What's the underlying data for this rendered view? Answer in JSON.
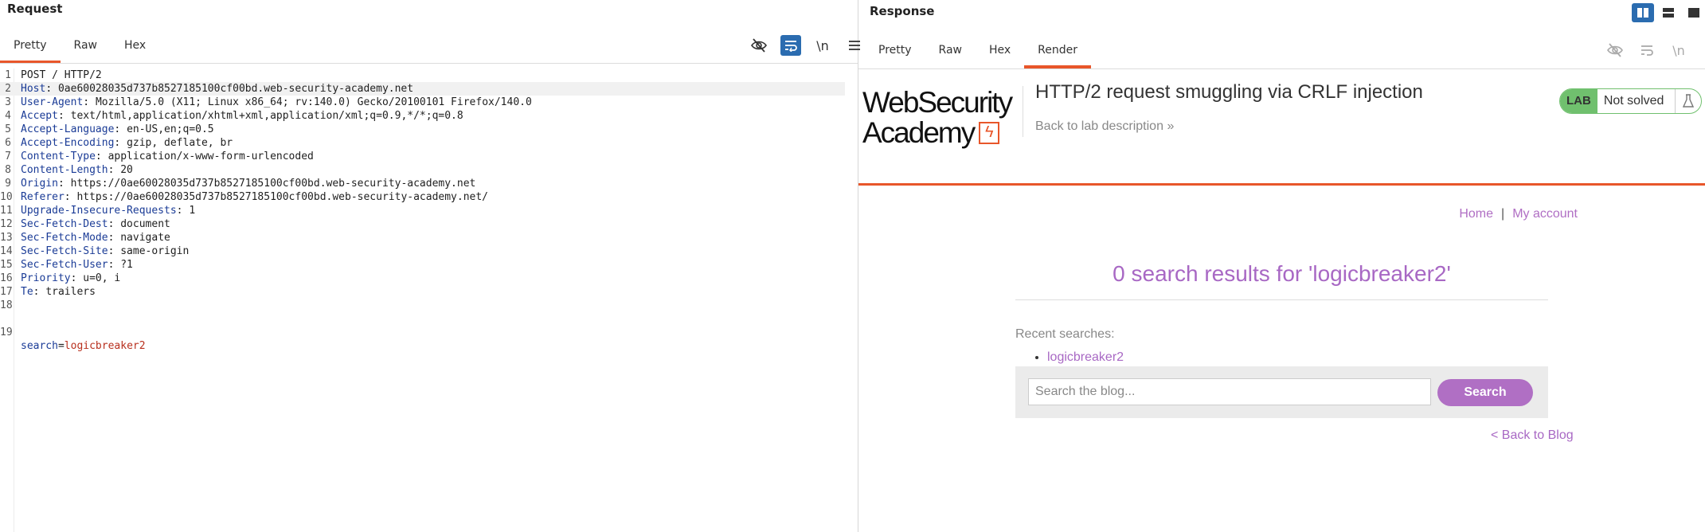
{
  "request": {
    "title": "Request",
    "tabs": [
      "Pretty",
      "Raw",
      "Hex"
    ],
    "active_tab": "Pretty",
    "toolbar": {
      "newline_label": "\\n"
    },
    "lines": [
      {
        "n": "1",
        "key": "",
        "value": "POST / HTTP/2"
      },
      {
        "n": "2",
        "key": "Host",
        "value": "0ae60028035d737b8527185100cf00bd.web-security-academy.net"
      },
      {
        "n": "3",
        "key": "User-Agent",
        "value": "Mozilla/5.0 (X11; Linux x86_64; rv:140.0) Gecko/20100101 Firefox/140.0"
      },
      {
        "n": "4",
        "key": "Accept",
        "value": "text/html,application/xhtml+xml,application/xml;q=0.9,*/*;q=0.8"
      },
      {
        "n": "5",
        "key": "Accept-Language",
        "value": "en-US,en;q=0.5"
      },
      {
        "n": "6",
        "key": "Accept-Encoding",
        "value": "gzip, deflate, br"
      },
      {
        "n": "7",
        "key": "Content-Type",
        "value": "application/x-www-form-urlencoded"
      },
      {
        "n": "8",
        "key": "Content-Length",
        "value": "20"
      },
      {
        "n": "9",
        "key": "Origin",
        "value": "https://0ae60028035d737b8527185100cf00bd.web-security-academy.net"
      },
      {
        "n": "10",
        "key": "Referer",
        "value": "https://0ae60028035d737b8527185100cf00bd.web-security-academy.net/"
      },
      {
        "n": "11",
        "key": "Upgrade-Insecure-Requests",
        "value": "1"
      },
      {
        "n": "12",
        "key": "Sec-Fetch-Dest",
        "value": "document"
      },
      {
        "n": "13",
        "key": "Sec-Fetch-Mode",
        "value": "navigate"
      },
      {
        "n": "14",
        "key": "Sec-Fetch-Site",
        "value": "same-origin"
      },
      {
        "n": "15",
        "key": "Sec-Fetch-User",
        "value": "?1"
      },
      {
        "n": "16",
        "key": "Priority",
        "value": "u=0, i"
      },
      {
        "n": "17",
        "key": "Te",
        "value": "trailers"
      },
      {
        "n": "18",
        "key": "",
        "value": ""
      }
    ],
    "body_line": {
      "n": "19",
      "param": "search",
      "eq": "=",
      "val": "logicbreaker2"
    }
  },
  "response": {
    "title": "Response",
    "tabs": [
      "Pretty",
      "Raw",
      "Hex",
      "Render"
    ],
    "active_tab": "Render",
    "toolbar": {
      "newline_label": "\\n"
    },
    "render": {
      "logo_line1": "WebSecurity",
      "logo_line2": "Academy",
      "logo_bolt": "ϟ",
      "lab_title": "HTTP/2 request smuggling via CRLF injection",
      "back_to_description": "Back to lab description",
      "back_chevron": "»",
      "lab_badge": "LAB",
      "lab_status": "Not solved",
      "nav_home": "Home",
      "nav_separator": "|",
      "nav_account": "My account",
      "results_heading": "0 search results for 'logicbreaker2'",
      "recent_label": "Recent searches:",
      "recent_searches": [
        "logicbreaker2"
      ],
      "search_placeholder": "Search the blog...",
      "search_button": "Search",
      "back_to_blog": "< Back to Blog"
    }
  },
  "colors": {
    "accent": "#e8562a",
    "link": "#a868c4",
    "header_key": "#1a3b96",
    "param_value": "#b8301e",
    "toggle_on": "#2b6cb0",
    "lab_green": "#70c06e"
  }
}
